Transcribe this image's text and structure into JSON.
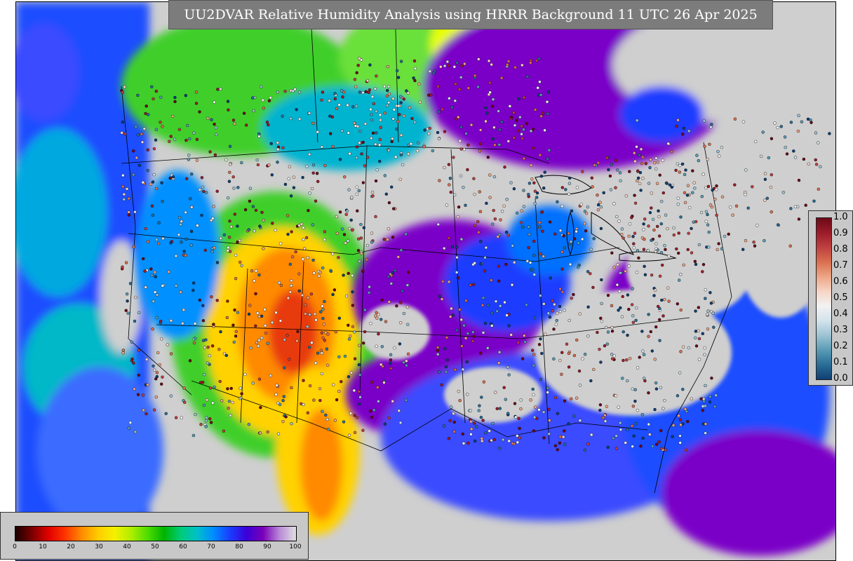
{
  "title": "UU2DVAR Relative Humidity Analysis using HRRR Background 11 UTC 26 Apr 2025",
  "observation_legend": {
    "ticks": [
      "1.0",
      "0.9",
      "0.8",
      "0.7",
      "0.6",
      "0.5",
      "0.4",
      "0.3",
      "0.2",
      "0.1",
      "0.0"
    ],
    "colors": [
      "#6b0a18",
      "#9b1c2a",
      "#bf4040",
      "#d9704f",
      "#eda685",
      "#f6d5c6",
      "#f2f2f2",
      "#d3e3ec",
      "#9cc3d3",
      "#5a9bb5",
      "#2a6d97",
      "#0f3f73"
    ]
  },
  "rh_colorbar": {
    "ticks": [
      "0",
      "10",
      "20",
      "30",
      "40",
      "50",
      "60",
      "70",
      "80",
      "90",
      "100"
    ],
    "colors": [
      "#1a0000",
      "#7a0000",
      "#e00000",
      "#ff3300",
      "#ff8a00",
      "#ffcc00",
      "#f5f000",
      "#b0ee00",
      "#4fdd00",
      "#00b400",
      "#00cc77",
      "#00c0c8",
      "#008cff",
      "#1a3cff",
      "#3b00d8",
      "#7a00b8",
      "#b88ad8",
      "#e0e0e0"
    ]
  },
  "colors": {
    "ocean_blue": "#2b4cff",
    "moist_purple": "#7a00c8",
    "saturated_gray": "#cfcfcf",
    "dry_red": "#e83a10",
    "dry_orange": "#ff9a00",
    "mid_green": "#3fcf2a"
  }
}
